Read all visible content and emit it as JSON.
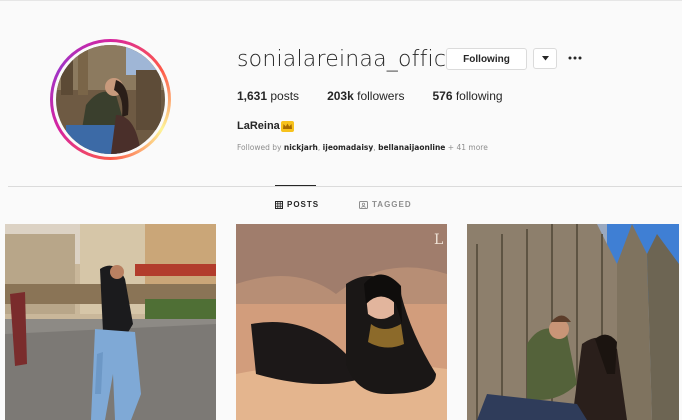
{
  "profile": {
    "username": "sonialareinaa_official",
    "following_button": "Following",
    "full_name": "LaReina",
    "stats": {
      "posts_count": "1,631",
      "posts_label": "posts",
      "followers_count": "203k",
      "followers_label": "followers",
      "following_count": "576",
      "following_label": "following"
    },
    "followed_by": {
      "prefix": "Followed by",
      "users": [
        "nickjarh",
        "ijeomadaisy",
        "bellanaijaonline"
      ],
      "more": "+ 41 more"
    }
  },
  "tabs": {
    "posts": "POSTS",
    "tagged": "TAGGED"
  },
  "icons": {
    "dropdown": "chevron-down-icon",
    "more": "more-horizontal-icon",
    "posts_tab": "grid-icon",
    "tagged_tab": "tag-icon",
    "name_emoji": "crown-icon"
  },
  "colors": {
    "ring_start": "#d6249f",
    "ring_end": "#fd5949",
    "text": "#262626",
    "muted": "#8e8e8e",
    "border": "#dbdbdb"
  }
}
